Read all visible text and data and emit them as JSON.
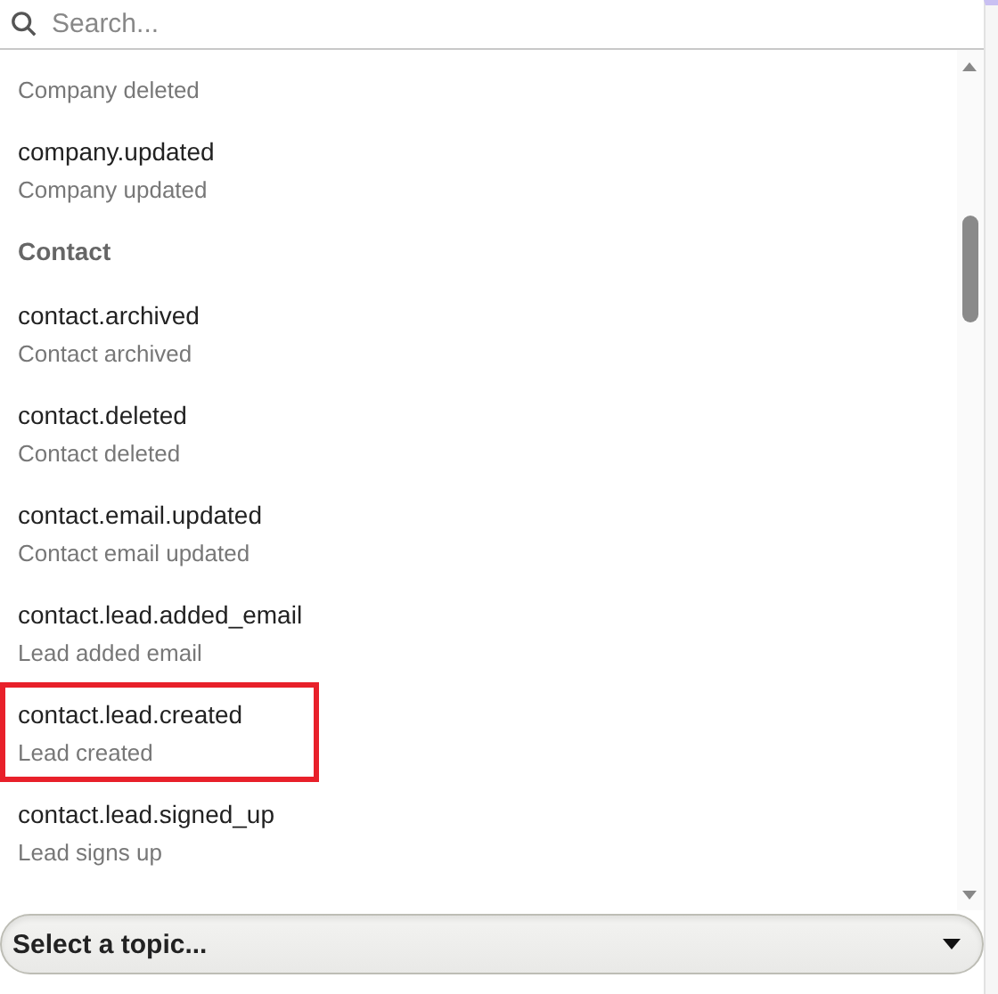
{
  "search": {
    "placeholder": "Search..."
  },
  "list": [
    {
      "kind": "event",
      "description": "Company deleted",
      "highlighted": false
    },
    {
      "kind": "event",
      "name": "company.updated",
      "description": "Company updated",
      "highlighted": false
    },
    {
      "kind": "group",
      "label": "Contact"
    },
    {
      "kind": "event",
      "name": "contact.archived",
      "description": "Contact archived",
      "highlighted": false
    },
    {
      "kind": "event",
      "name": "contact.deleted",
      "description": "Contact deleted",
      "highlighted": false
    },
    {
      "kind": "event",
      "name": "contact.email.updated",
      "description": "Contact email updated",
      "highlighted": false
    },
    {
      "kind": "event",
      "name": "contact.lead.added_email",
      "description": "Lead added email",
      "highlighted": false
    },
    {
      "kind": "event",
      "name": "contact.lead.created",
      "description": "Lead created",
      "highlighted": true
    },
    {
      "kind": "event",
      "name": "contact.lead.signed_up",
      "description": "Lead signs up",
      "highlighted": false
    }
  ],
  "topic_select": {
    "label": "Select a topic..."
  }
}
